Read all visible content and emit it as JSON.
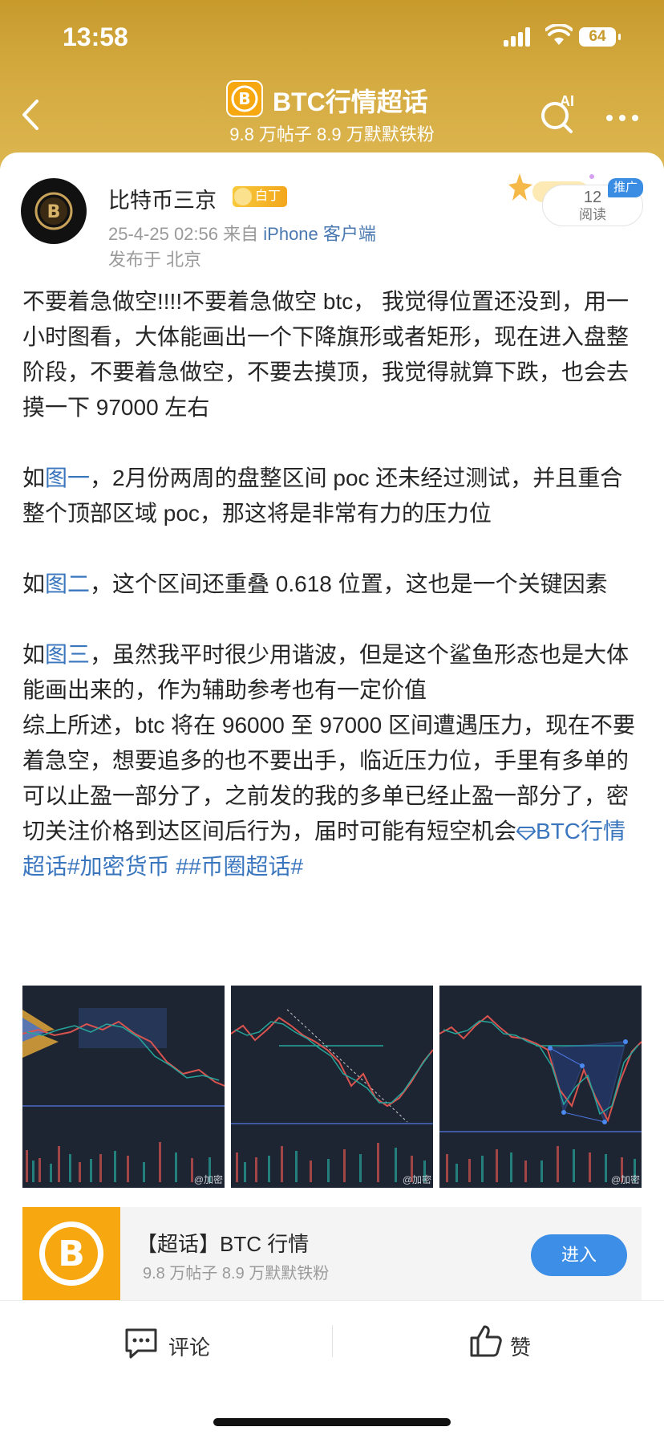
{
  "status": {
    "time": "13:58",
    "battery": "64"
  },
  "header": {
    "title": "BTC行情超话",
    "subtitle": "9.8 万帖子 8.9 万默默铁粉",
    "ai_label": "AI"
  },
  "post": {
    "author": "比特币三京",
    "badge": "白丁",
    "date": "25-4-25 02:56",
    "source_prefix": "来自",
    "source_client": "iPhone 客户端",
    "location": "发布于 北京",
    "promo_tag": "推广",
    "read_count": "12",
    "read_label": "阅读",
    "p1": "不要着急做空!!!!不要着急做空 btc， 我觉得位置还没到，用一小时图看，大体能画出一个下降旗形或者矩形，现在进入盘整阶段，不要着急做空，不要去摸顶，我觉得就算下跌，也会去摸一下 97000 左右",
    "p2_prefix": "如",
    "p2_link": "图一",
    "p2_text": "，2月份两周的盘整区间 poc 还未经过测试，并且重合整个顶部区域 poc，那这将是非常有力的压力位",
    "p3_prefix": "如",
    "p3_link": "图二",
    "p3_text": "，这个区间还重叠 0.618 位置，这也是一个关键因素",
    "p4_prefix": "如",
    "p4_link": "图三",
    "p4_text": "，虽然我平时很少用谐波，但是这个鲨鱼形态也是大体能画出来的，作为辅助参考也有一定价值",
    "p5_text": "综上所述，btc 将在 96000 至 97000 区间遭遇压力，现在不要着急空，想要追多的也不要出手，临近压力位，手里有多单的可以止盈一部分了，之前发的我的多单已经止盈一部分了，密切关注价格到达区间后行为，届时可能有短空机会",
    "tag1": "BTC行情超话",
    "tag2": "#加密货币",
    "tag3": " ##币圈超话#"
  },
  "images": [
    {
      "watermark": "@加密"
    },
    {
      "watermark": "@加密"
    },
    {
      "watermark": "@加密"
    }
  ],
  "topic_card": {
    "name": "【超话】BTC 行情",
    "stats": "9.8 万帖子 8.9 万默默铁粉",
    "enter_label": "进入"
  },
  "actions": {
    "comment_label": "评论",
    "like_label": "赞"
  },
  "colors": {
    "header_gold": "#c79a2c",
    "link_blue": "#3a76be",
    "button_blue": "#3d8ee6",
    "btc_orange": "#f7a70f"
  }
}
